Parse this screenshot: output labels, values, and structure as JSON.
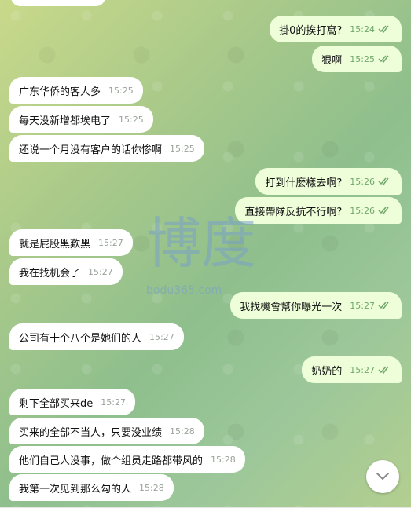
{
  "messages": [
    {
      "dir": "out",
      "text": "掛0的挨打窩?",
      "time": "15:24"
    },
    {
      "dir": "out",
      "text": "狠啊",
      "time": "15:25"
    },
    {
      "dir": "in",
      "text": "广东华侨的客人多",
      "time": "15:25"
    },
    {
      "dir": "in",
      "text": "每天没新增都埃电了",
      "time": "15:25"
    },
    {
      "dir": "in",
      "text": "还说一个月没有客户的话你惨啊",
      "time": "15:25"
    },
    {
      "dir": "out",
      "text": "打到什麼樣去啊?",
      "time": "15:26"
    },
    {
      "dir": "out",
      "text": "直接帶隊反抗不行啊?",
      "time": "15:26"
    },
    {
      "dir": "in",
      "text": "就是屁股黑歎黑",
      "time": "15:27"
    },
    {
      "dir": "in",
      "text": "我在找机会了",
      "time": "15:27"
    },
    {
      "dir": "out",
      "text": "我找機會幫你曝光一次",
      "time": "15:27"
    },
    {
      "dir": "in",
      "text": "公司有十个八个是她们的人",
      "time": "15:27"
    },
    {
      "dir": "out",
      "text": "奶奶的",
      "time": "15:27"
    },
    {
      "dir": "in",
      "text": "剩下全部买来de",
      "time": "15:27"
    },
    {
      "dir": "in",
      "text": "买来的全部不当人，只要没业绩",
      "time": "15:28"
    },
    {
      "dir": "in",
      "text": "他们自己人没事，做个组员走路都带风的",
      "time": "15:28"
    },
    {
      "dir": "in",
      "text": "我第一次见到那么勾的人",
      "time": "15:28"
    }
  ],
  "watermark": {
    "text": "博度",
    "sub": "bodu365.com"
  },
  "colors": {
    "incoming": "#ffffff",
    "outgoing": "#eefed9",
    "time_out": "#6fa76a"
  },
  "icons": {
    "read": "double-check-icon",
    "scroll": "chevron-down-icon"
  }
}
